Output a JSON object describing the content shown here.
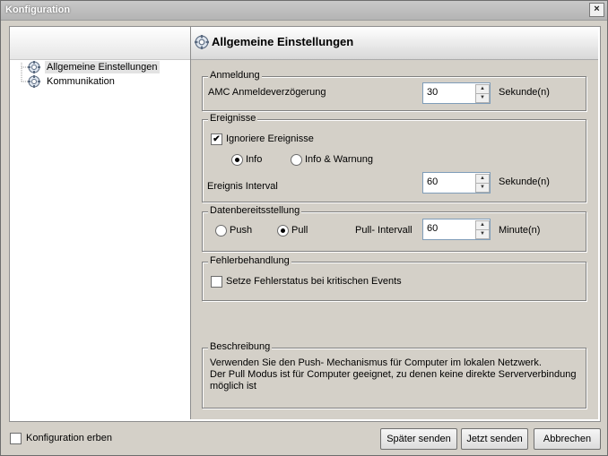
{
  "window": {
    "title": "Konfiguration",
    "close_label": "×"
  },
  "tree": {
    "items": [
      {
        "label": "Allgemeine Einstellungen",
        "selected": true
      },
      {
        "label": "Kommunikation",
        "selected": false
      }
    ]
  },
  "header": {
    "title": "Allgemeine Einstellungen"
  },
  "anmeldung": {
    "legend": "Anmeldung",
    "delay_label": "AMC Anmeldeverzögerung",
    "delay_value": "30",
    "delay_unit": "Sekunde(n)"
  },
  "ereignisse": {
    "legend": "Ereignisse",
    "ignore_label": "Ignoriere Ereignisse",
    "ignore_checked": true,
    "radio_info": "Info",
    "radio_info_warn": "Info & Warnung",
    "interval_label": "Ereignis Interval",
    "interval_value": "60",
    "interval_unit": "Sekunde(n)"
  },
  "daten": {
    "legend": "Datenbereitsstellung",
    "push_label": "Push",
    "pull_label": "Pull",
    "pull_interval_label": "Pull- Intervall",
    "pull_interval_value": "60",
    "pull_interval_unit": "Minute(n)"
  },
  "fehler": {
    "legend": "Fehlerbehandlung",
    "checkbox_label": "Setze Fehlerstatus bei kritischen Events",
    "checked": false
  },
  "beschreibung": {
    "legend": "Beschreibung",
    "line1": "Verwenden Sie den Push- Mechanismus für Computer im lokalen Netzwerk.",
    "line2": "Der Pull Modus ist für Computer geeignet, zu denen keine direkte Serververbindung",
    "line3": "möglich ist"
  },
  "footer": {
    "inherit_label": "Konfiguration erben",
    "later_button": "Später senden",
    "now_button": "Jetzt senden",
    "cancel_button": "Abbrechen"
  },
  "icons": {
    "tree_item": "gear-globe-icon",
    "header": "gear-globe-icon",
    "checkmark": "✔"
  }
}
